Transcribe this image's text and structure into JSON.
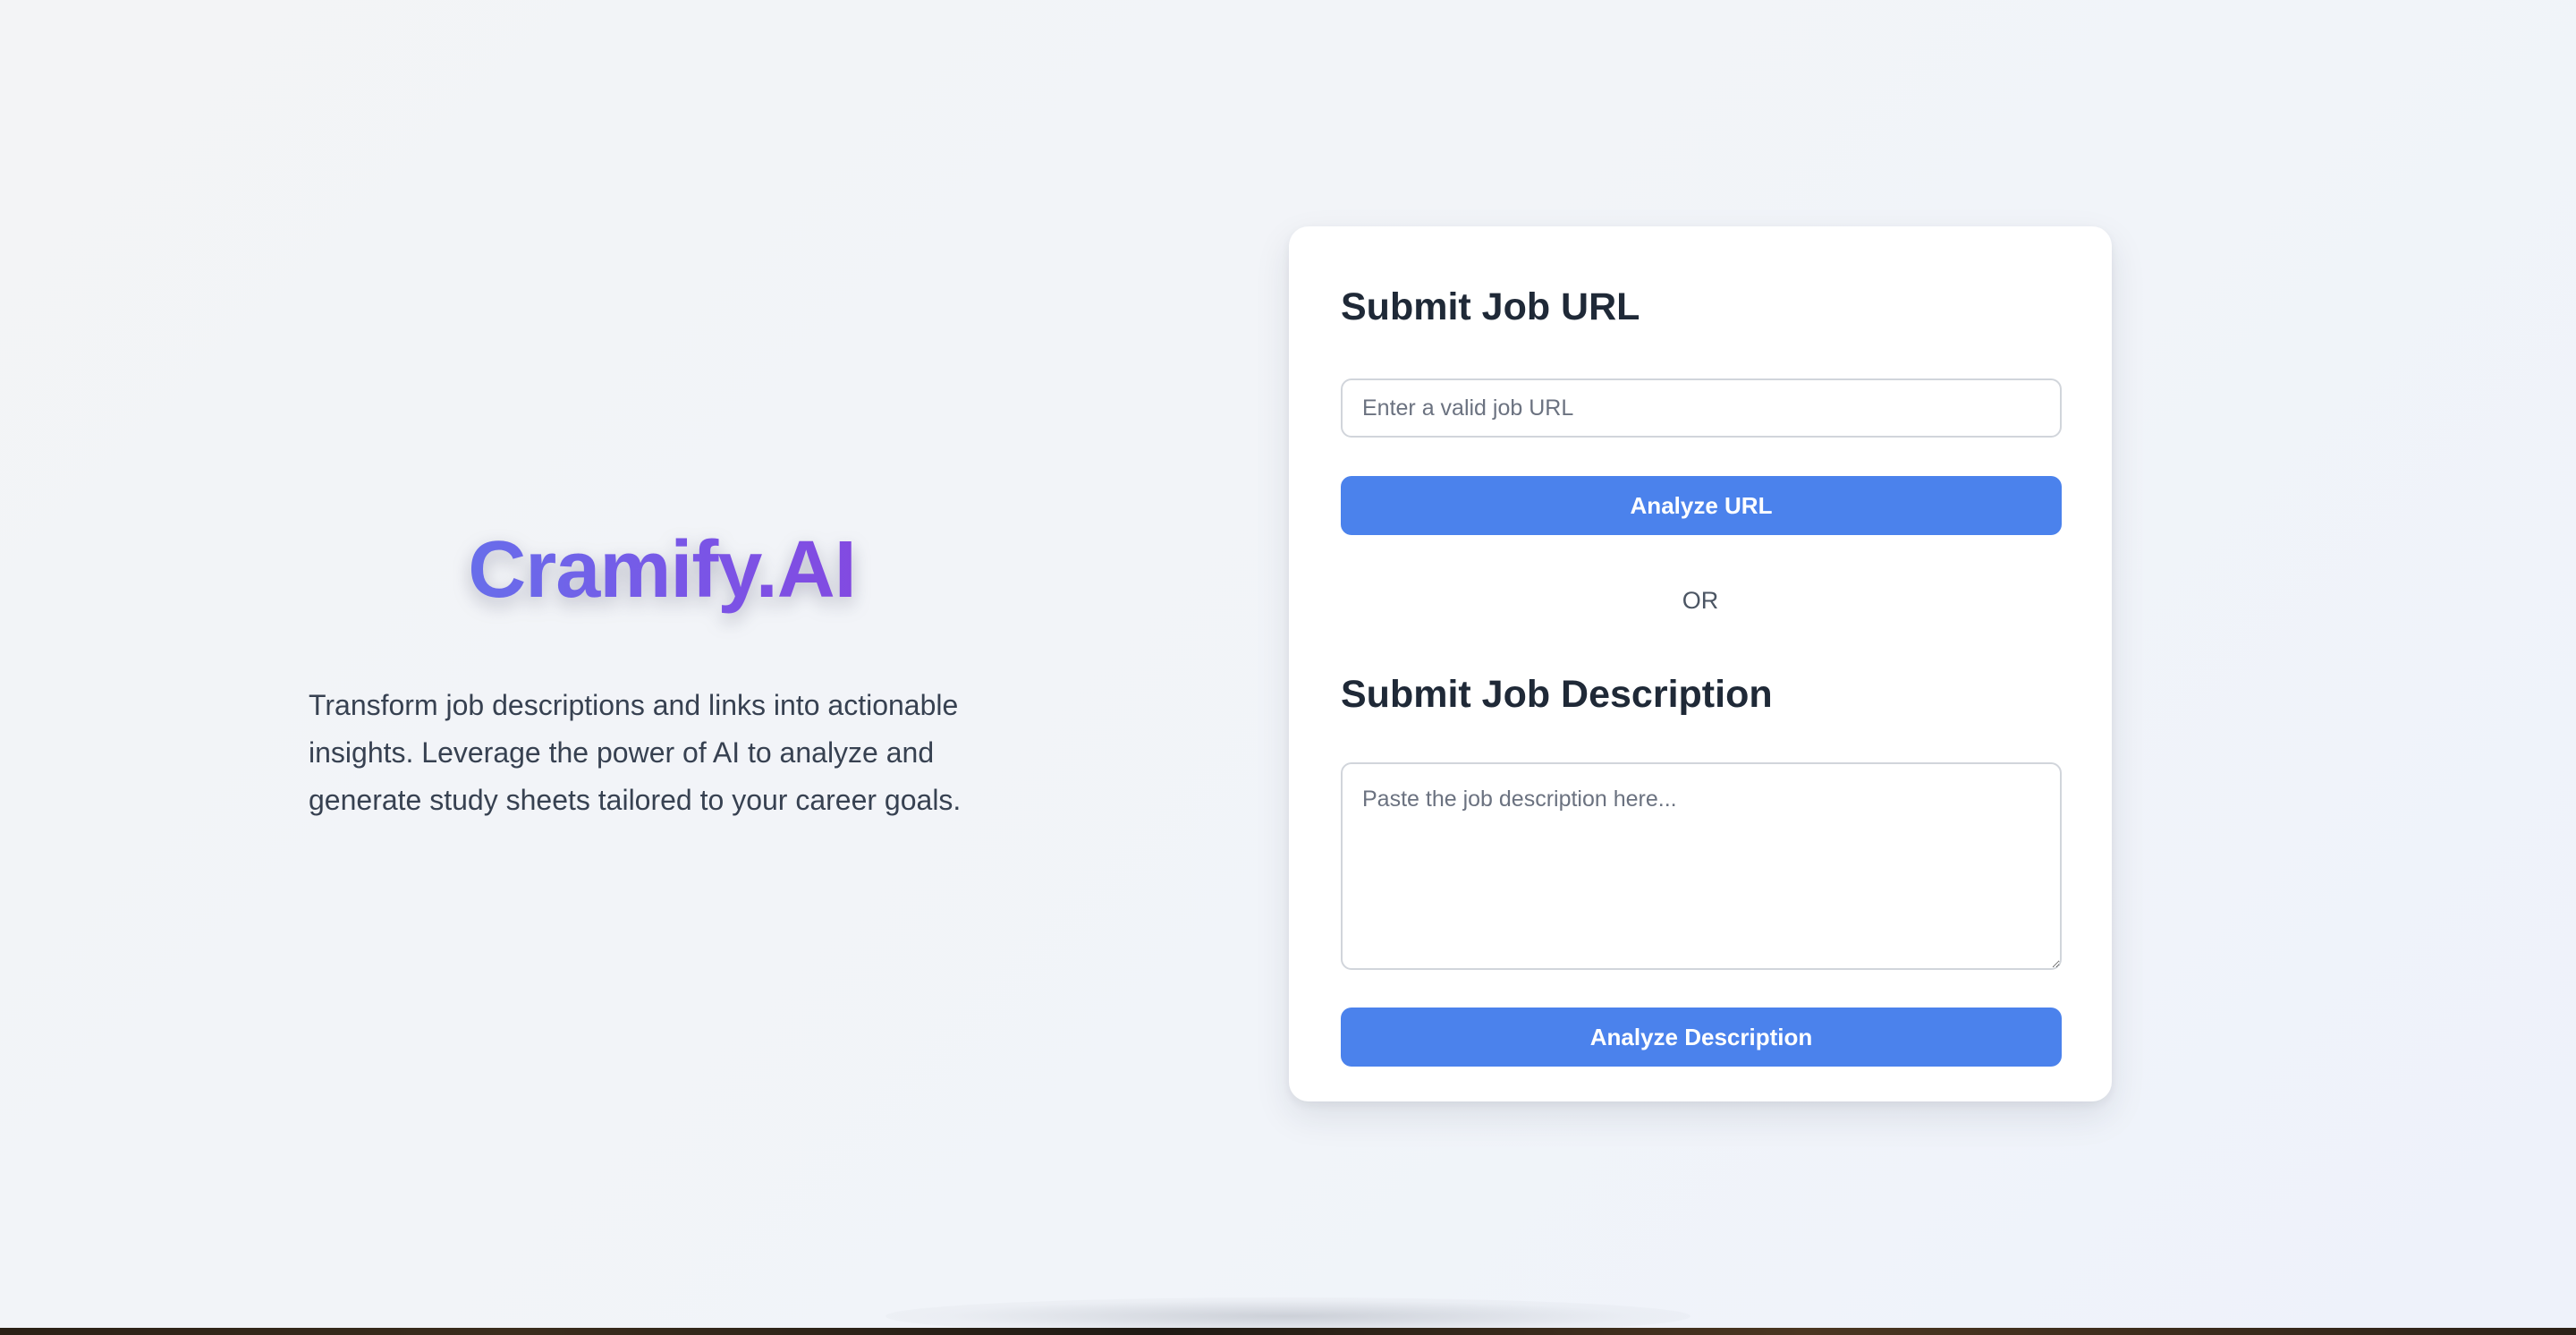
{
  "brand": {
    "name": "Cramify.AI",
    "tagline": "Transform job descriptions and links into actionable insights. Leverage the power of AI to analyze and generate study sheets tailored to your career goals."
  },
  "url_section": {
    "title": "Submit Job URL",
    "input_value": "",
    "input_placeholder": "Enter a valid job URL",
    "button_label": "Analyze URL"
  },
  "divider": {
    "label": "OR"
  },
  "description_section": {
    "title": "Submit Job Description",
    "textarea_value": "",
    "textarea_placeholder": "Paste the job description here...",
    "button_label": "Analyze Description"
  },
  "colors": {
    "accent": "#4b82ec",
    "brand_gradient_start": "#5b7fee",
    "brand_gradient_end": "#8a3fdc",
    "background": "#f1f4f9",
    "card": "#ffffff",
    "heading_text": "#1f2937",
    "body_text": "#374151"
  }
}
